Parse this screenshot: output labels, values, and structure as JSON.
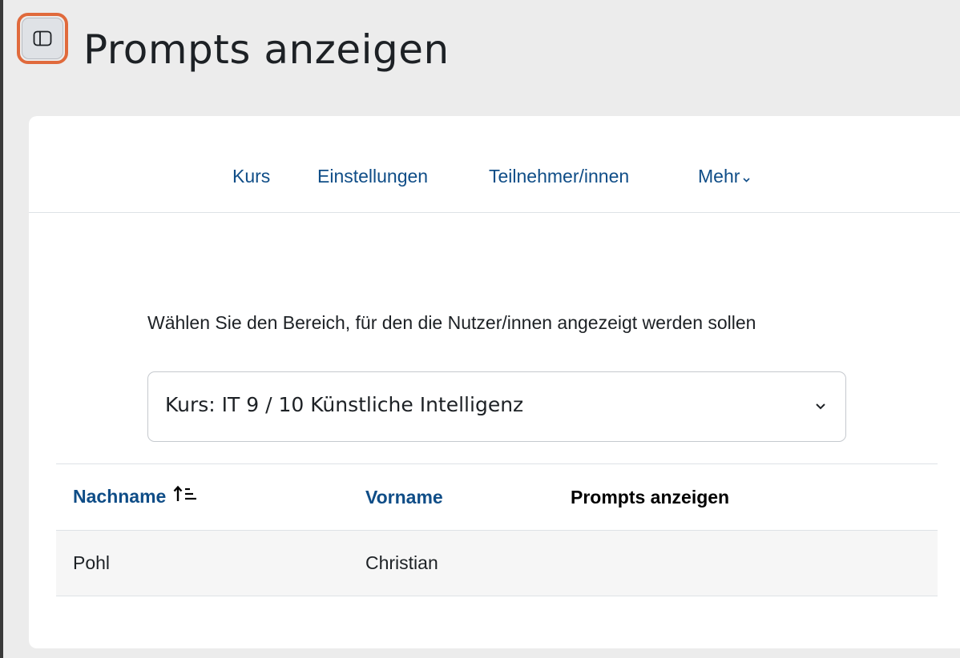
{
  "header": {
    "title": "Prompts anzeigen",
    "drawer_toggle_icon": "sidebar-panel-icon"
  },
  "nav": {
    "items": [
      {
        "label": "Kurs"
      },
      {
        "label": "Einstellungen"
      },
      {
        "label": "Teilnehmer/innen"
      },
      {
        "label": "Mehr"
      }
    ],
    "more_icon": "chevron-down-icon"
  },
  "area_select": {
    "label": "Wählen Sie den Bereich, für den die Nutzer/innen angezeigt werden sollen",
    "selected_value": "Kurs: IT 9 / 10 Künstliche Intelligenz"
  },
  "table": {
    "columns": [
      {
        "label": "Nachname",
        "sortable": true,
        "sort": "ascending"
      },
      {
        "label": "Vorname",
        "sortable": true
      },
      {
        "label": "Prompts anzeigen",
        "sortable": false
      }
    ],
    "rows": [
      {
        "nachname": "Pohl",
        "vorname": "Christian",
        "prompts": ""
      }
    ]
  },
  "colors": {
    "link": "#0f4d87",
    "focus_ring": "#e06a3c",
    "background": "#ececec",
    "card": "#ffffff",
    "row_stripe": "#f6f6f6"
  }
}
